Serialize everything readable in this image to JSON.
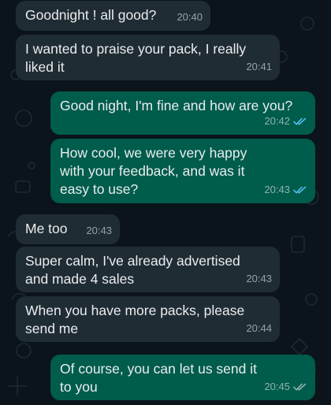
{
  "colors": {
    "background": "#0b141a",
    "incoming_bubble": "#202c33",
    "outgoing_bubble": "#005c4b",
    "text": "#e9edef",
    "read_ticks": "#53bdeb"
  },
  "messages": [
    {
      "direction": "incoming",
      "text": "Goodnight ! all good?",
      "time": "20:40"
    },
    {
      "direction": "incoming",
      "text": "I wanted to praise your pack, I really liked it",
      "time": "20:41"
    },
    {
      "direction": "outgoing",
      "text": "Good night, I'm fine and how are you?",
      "time": "20:42",
      "status_icon": "double-check-read-icon"
    },
    {
      "direction": "outgoing",
      "text": "How cool, we were very happy with your feedback, and was it easy to use?",
      "time": "20:43",
      "status_icon": "double-check-read-icon"
    },
    {
      "direction": "incoming",
      "text": "Me too",
      "time": "20:43"
    },
    {
      "direction": "incoming",
      "text": "Super calm, I've already advertised and made 4 sales",
      "time": "20:43"
    },
    {
      "direction": "incoming",
      "text": "When you have more packs, please send me",
      "time": "20:44"
    },
    {
      "direction": "outgoing",
      "text": "Of course, you can let us send it to you",
      "time": "20:45",
      "status_icon": "double-check-icon"
    }
  ]
}
